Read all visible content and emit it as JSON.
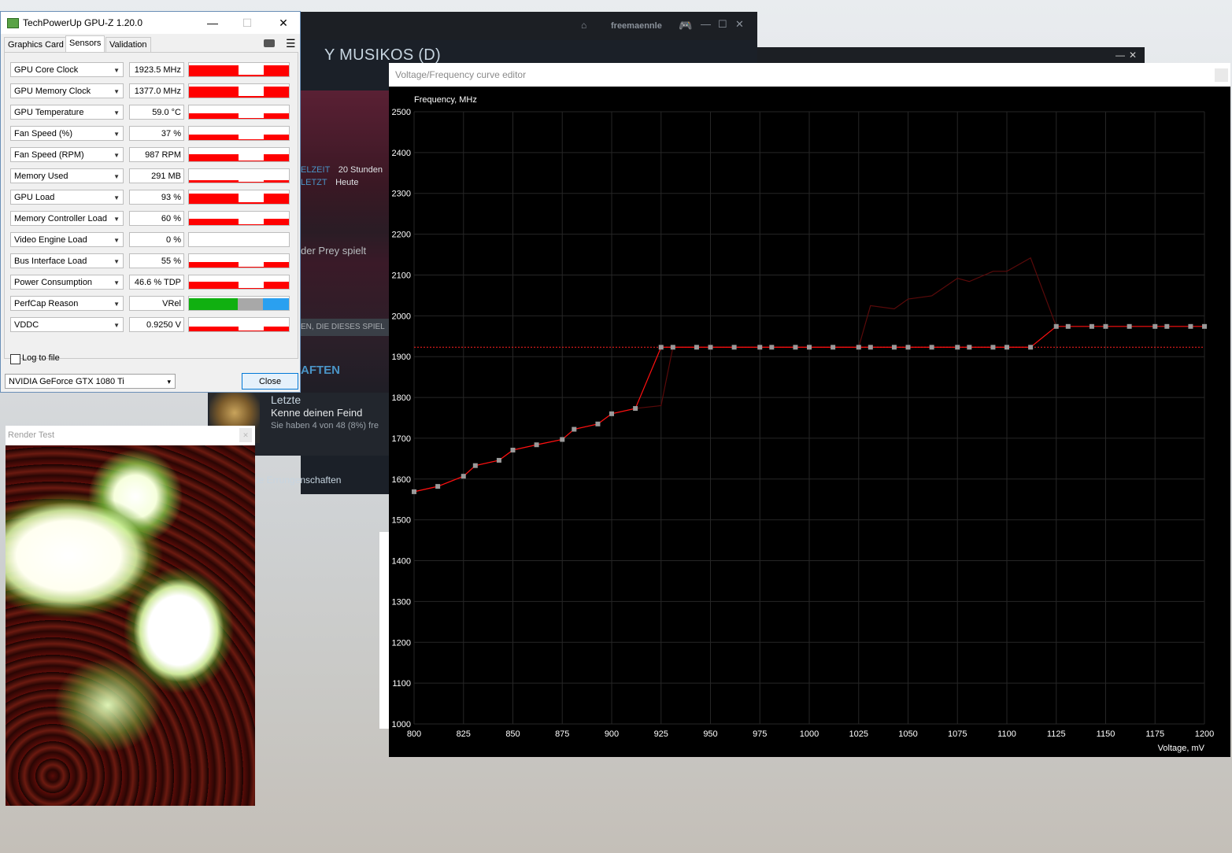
{
  "gpuz": {
    "title": "TechPowerUp GPU-Z 1.20.0",
    "tabs": [
      "Graphics Card",
      "Sensors",
      "Validation"
    ],
    "active_tab": "Sensors",
    "sensors": [
      {
        "name": "GPU Core Clock",
        "value": "1923.5 MHz",
        "level": 0.85
      },
      {
        "name": "GPU Memory Clock",
        "value": "1377.0 MHz",
        "level": 0.85
      },
      {
        "name": "GPU Temperature",
        "value": "59.0 °C",
        "level": 0.45
      },
      {
        "name": "Fan Speed (%)",
        "value": "37 %",
        "level": 0.45
      },
      {
        "name": "Fan Speed (RPM)",
        "value": "987 RPM",
        "level": 0.55
      },
      {
        "name": "Memory Used",
        "value": "291 MB",
        "level": 0.2
      },
      {
        "name": "GPU Load",
        "value": "93 %",
        "level": 0.8
      },
      {
        "name": "Memory Controller Load",
        "value": "60 %",
        "level": 0.5
      },
      {
        "name": "Video Engine Load",
        "value": "0 %",
        "level": 0
      },
      {
        "name": "Bus Interface Load",
        "value": "55 %",
        "level": 0.45
      },
      {
        "name": "Power Consumption",
        "value": "46.6 % TDP",
        "level": 0.55
      },
      {
        "name": "PerfCap Reason",
        "value": "VRel",
        "level": 1
      },
      {
        "name": "VDDC",
        "value": "0.9250 V",
        "level": 0.4
      }
    ],
    "log_to_file_label": "Log to file",
    "log_to_file_checked": false,
    "gpu_select": "NVIDIA GeForce GTX 1080 Ti",
    "close_label": "Close",
    "graph_color": "#ff0000"
  },
  "steam": {
    "username": "freemaennle",
    "title_fragment": "Y   MUSIKOS (D)",
    "stats": [
      {
        "key": "ELZEIT",
        "value": "20 Stunden"
      },
      {
        "key": "LETZT",
        "value": "Heute"
      }
    ],
    "friends_text": "der Prey spielt",
    "category_text": "EN, DIE DIESES SPIEL",
    "section_title": "AFTEN",
    "achievement": {
      "line1": "Letzte",
      "line2": "Kenne deinen Feind",
      "line3": "Sie haben 4 von 48 (8%) fre"
    },
    "bottom_text": "de Errungenschaften"
  },
  "render_test": {
    "title": "Render Test"
  },
  "vf_editor": {
    "title": "Voltage/Frequency curve editor",
    "chart_data": {
      "type": "line",
      "ylabel": "Frequency, MHz",
      "xlabel": "Voltage, mV",
      "xlim": [
        800,
        1200
      ],
      "ylim": [
        1000,
        2500
      ],
      "x_ticks": [
        800,
        825,
        850,
        875,
        900,
        925,
        950,
        975,
        1000,
        1025,
        1050,
        1075,
        1100,
        1125,
        1150,
        1175,
        1200
      ],
      "y_ticks": [
        1000,
        1100,
        1200,
        1300,
        1400,
        1500,
        1600,
        1700,
        1800,
        1900,
        2000,
        2100,
        2200,
        2300,
        2400,
        2500
      ],
      "grid": true,
      "reference_line": {
        "y": 1923,
        "color": "#ff2020",
        "style": "dotted"
      },
      "series": [
        {
          "color": "#ff1010",
          "points": [
            [
              800,
              1569
            ],
            [
              812,
              1582
            ],
            [
              825,
              1607
            ],
            [
              831,
              1633
            ],
            [
              843,
              1646
            ],
            [
              850,
              1671
            ],
            [
              862,
              1684
            ],
            [
              875,
              1697
            ],
            [
              881,
              1722
            ],
            [
              893,
              1735
            ],
            [
              900,
              1760
            ],
            [
              912,
              1773
            ],
            [
              925,
              1923
            ],
            [
              931,
              1923
            ],
            [
              943,
              1923
            ],
            [
              950,
              1923
            ],
            [
              962,
              1923
            ],
            [
              975,
              1923
            ],
            [
              981,
              1923
            ],
            [
              993,
              1923
            ],
            [
              1000,
              1923
            ],
            [
              1012,
              1923
            ],
            [
              1025,
              1923
            ],
            [
              1031,
              1923
            ],
            [
              1043,
              1923
            ],
            [
              1050,
              1923
            ],
            [
              1062,
              1923
            ],
            [
              1075,
              1923
            ],
            [
              1081,
              1923
            ],
            [
              1093,
              1923
            ],
            [
              1100,
              1923
            ],
            [
              1112,
              1923
            ],
            [
              1125,
              1974
            ],
            [
              1131,
              1974
            ],
            [
              1143,
              1974
            ],
            [
              1150,
              1974
            ],
            [
              1162,
              1974
            ],
            [
              1175,
              1974
            ],
            [
              1181,
              1974
            ],
            [
              1193,
              1974
            ],
            [
              1200,
              1974
            ]
          ]
        },
        {
          "color": "#5a0a0a",
          "points": [
            [
              800,
              1569
            ],
            [
              812,
              1582
            ],
            [
              825,
              1607
            ],
            [
              831,
              1633
            ],
            [
              843,
              1646
            ],
            [
              850,
              1671
            ],
            [
              862,
              1684
            ],
            [
              875,
              1697
            ],
            [
              881,
              1722
            ],
            [
              893,
              1735
            ],
            [
              900,
              1760
            ],
            [
              912,
              1773
            ],
            [
              925,
              1780
            ],
            [
              931,
              1923
            ],
            [
              1025,
              1923
            ],
            [
              1031,
              2025
            ],
            [
              1043,
              2017
            ],
            [
              1050,
              2041
            ],
            [
              1062,
              2049
            ],
            [
              1075,
              2092
            ],
            [
              1081,
              2084
            ],
            [
              1093,
              2109
            ],
            [
              1100,
              2109
            ],
            [
              1112,
              2142
            ],
            [
              1125,
              1974
            ]
          ]
        }
      ]
    }
  }
}
